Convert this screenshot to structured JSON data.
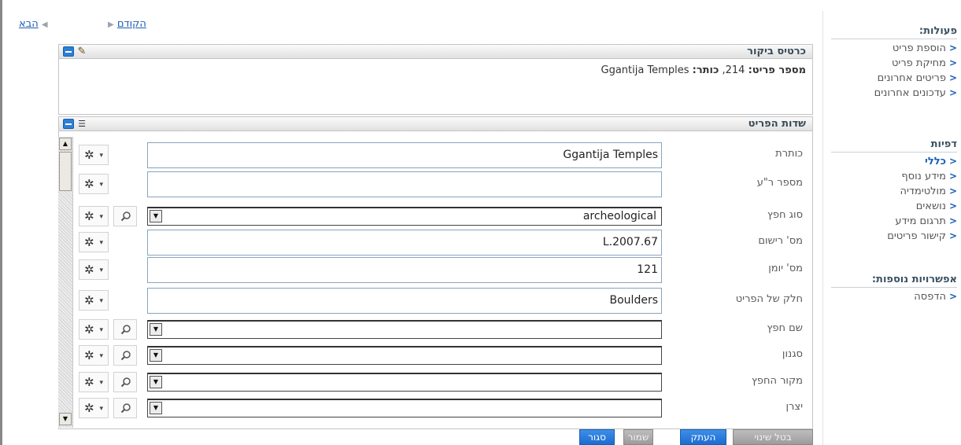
{
  "nav": {
    "prev_label": "הקודם",
    "next_label": "הבא"
  },
  "sidebar": {
    "actions": {
      "title": "פעולות:",
      "items": [
        "הוספת פריט",
        "מחיקת פריט",
        "פריטים אחרונים",
        "עדכונים אחרונים"
      ]
    },
    "pages": {
      "title": "דפיות",
      "items": [
        "כללי",
        "מידע נוסף",
        "מולטימדיה",
        "נושאים",
        "תרגום מידע",
        "קישור פריטים"
      ],
      "active": "כללי"
    },
    "more": {
      "title": "אפשרויות נוספות:",
      "items": [
        "הדפסה"
      ]
    }
  },
  "card": {
    "title": "כרטיס ביקור",
    "item_number_label": "מספר פריט:",
    "item_number": "214",
    "sep": ",",
    "title_label": "כותר:",
    "title_value": "Ggantija Temples"
  },
  "fields_panel": {
    "title": "שדות הפריט",
    "fields": [
      {
        "label": "כותרת",
        "type": "text",
        "value": "Ggantija Temples",
        "search": false
      },
      {
        "label": "מספר ר\"ע",
        "type": "text",
        "value": "",
        "search": false
      },
      {
        "label": "סוג חפץ",
        "type": "select",
        "value": "archeological",
        "search": true
      },
      {
        "label": "מס' רישום",
        "type": "text",
        "value": "L.2007.67",
        "search": false
      },
      {
        "label": "מס' יומן",
        "type": "text",
        "value": "121",
        "search": false
      },
      {
        "label": "חלק של הפריט",
        "type": "text",
        "value": "Boulders",
        "search": false
      },
      {
        "label": "שם חפץ",
        "type": "select",
        "value": "",
        "search": true
      },
      {
        "label": "סגנון",
        "type": "select",
        "value": "",
        "search": true
      },
      {
        "label": "מקור החפץ",
        "type": "select",
        "value": "",
        "search": true
      },
      {
        "label": "יצרן",
        "type": "select",
        "value": "",
        "search": true
      }
    ]
  },
  "buttons": {
    "cancel_changes": "בטל שינוי",
    "copy": "העתק",
    "save": "שמור",
    "close": "סגור"
  },
  "icons": {
    "edit": "pencil-icon",
    "collapse": "minus-icon",
    "tree": "tree-list-icon",
    "gear": "gear-icon",
    "search": "magnifier-icon",
    "dropdown": "triangle-down-icon"
  },
  "colors": {
    "link": "#1a5fb4",
    "accent_button": "#1c6cd1",
    "panel_border": "#c4c4c4"
  }
}
